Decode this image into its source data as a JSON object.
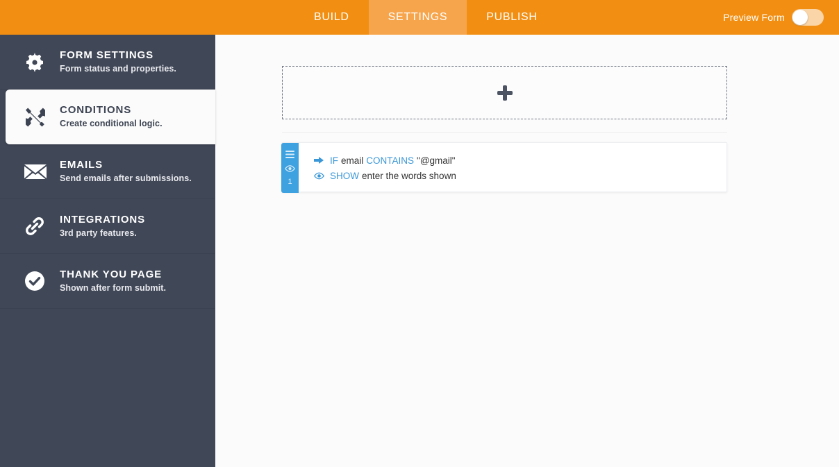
{
  "topbar": {
    "tabs": [
      {
        "label": "BUILD",
        "active": false
      },
      {
        "label": "SETTINGS",
        "active": true
      },
      {
        "label": "PUBLISH",
        "active": false
      }
    ],
    "preview_label": "Preview Form",
    "preview_toggle_state": "off",
    "background_color": "#f28f12",
    "active_tab_color": "#f7a54c"
  },
  "sidebar": {
    "background_color": "#404757",
    "items": [
      {
        "icon": "gear-icon",
        "title": "FORM SETTINGS",
        "subtitle": "Form status and properties.",
        "active": false
      },
      {
        "icon": "crossed-tools-icon",
        "title": "CONDITIONS",
        "subtitle": "Create conditional logic.",
        "active": true
      },
      {
        "icon": "envelope-icon",
        "title": "EMAILS",
        "subtitle": "Send emails after submissions.",
        "active": false
      },
      {
        "icon": "link-icon",
        "title": "INTEGRATIONS",
        "subtitle": "3rd party features.",
        "active": false
      },
      {
        "icon": "check-circle-icon",
        "title": "THANK YOU PAGE",
        "subtitle": "Shown after form submit.",
        "active": false
      }
    ]
  },
  "main": {
    "add_condition": {
      "icon": "plus-icon",
      "label": ""
    },
    "conditions": [
      {
        "number": "1",
        "strip_color": "#3ea2e0",
        "menu_icon": "hamburger-icon",
        "visibility_icon": "eye-icon",
        "lines": [
          {
            "icon": "arrow-right-icon",
            "keyword": "IF",
            "field": "email",
            "operator": "CONTAINS",
            "value": "\"@gmail\""
          },
          {
            "icon": "eye-icon",
            "keyword": "SHOW",
            "field": "enter the words shown",
            "operator": "",
            "value": ""
          }
        ]
      }
    ]
  }
}
